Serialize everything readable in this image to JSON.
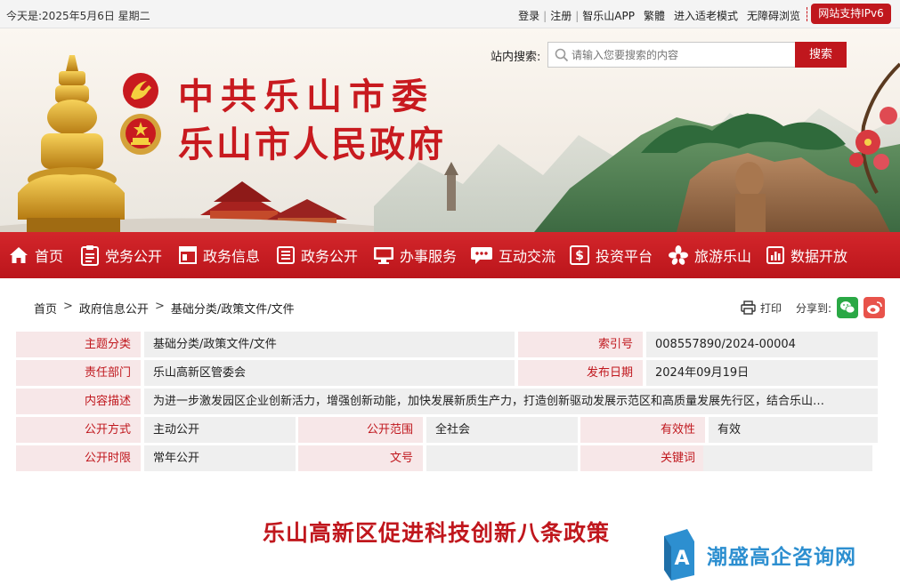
{
  "topbar": {
    "date": "今天是:2025年5月6日 星期二",
    "links": [
      "登录",
      "注册",
      "智乐山APP",
      "繁體",
      "进入适老模式",
      "无障碍浏览"
    ],
    "ipv6": "网站支持IPv6"
  },
  "banner": {
    "title_line1": "中共乐山市委",
    "title_line2": "乐山市人民政府"
  },
  "search": {
    "label": "站内搜索:",
    "placeholder": "请输入您要搜索的内容",
    "button": "搜索"
  },
  "nav": {
    "items": [
      {
        "label": "首页",
        "icon": "home-icon"
      },
      {
        "label": "党务公开",
        "icon": "clipboard-icon"
      },
      {
        "label": "政务信息",
        "icon": "window-icon"
      },
      {
        "label": "政务公开",
        "icon": "list-icon"
      },
      {
        "label": "办事服务",
        "icon": "monitor-icon"
      },
      {
        "label": "互动交流",
        "icon": "chat-icon"
      },
      {
        "label": "投资平台",
        "icon": "dollar-icon"
      },
      {
        "label": "旅游乐山",
        "icon": "flower-icon"
      },
      {
        "label": "数据开放",
        "icon": "chart-icon"
      }
    ]
  },
  "breadcrumb": [
    "首页",
    "政府信息公开",
    "基础分类/政策文件/文件"
  ],
  "tools": {
    "print": "打印",
    "share": "分享到:"
  },
  "meta": {
    "subject_label": "主题分类",
    "subject": "基础分类/政策文件/文件",
    "index_label": "索引号",
    "index": "008557890/2024-00004",
    "dept_label": "责任部门",
    "dept": "乐山高新区管委会",
    "date_label": "发布日期",
    "date": "2024年09月19日",
    "desc_label": "内容描述",
    "desc": "为进一步激发园区企业创新活力，增强创新动能，加快发展新质生产力，打造创新驱动发展示范区和高质量发展先行区，结合乐山…",
    "mode_label": "公开方式",
    "mode": "主动公开",
    "scope_label": "公开范围",
    "scope": "全社会",
    "validity_label": "有效性",
    "validity": "有效",
    "period_label": "公开时限",
    "period": "常年公开",
    "docno_label": "文号",
    "docno": "",
    "keyword_label": "关键词",
    "keyword": ""
  },
  "article": {
    "title": "乐山高新区促进科技创新八条政策"
  },
  "watermark": {
    "text": "潮盛高企咨询网"
  },
  "colors": {
    "brand_red": "#c0171d",
    "label_bg": "#f7e7e8",
    "value_bg": "#efefef",
    "watermark_blue": "#2d8fd0"
  }
}
